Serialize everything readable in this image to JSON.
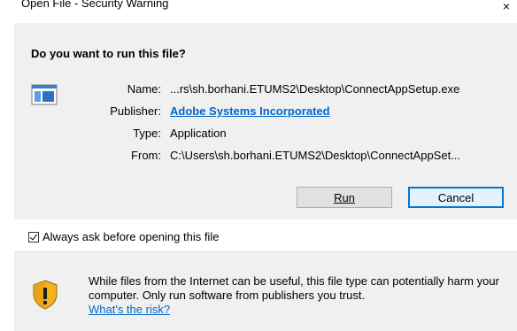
{
  "window": {
    "title": "Open File - Security Warning",
    "close_glyph": "×"
  },
  "question": "Do you want to run this file?",
  "details": {
    "name_label": "Name:",
    "name_value": "...rs\\sh.borhani.ETUMS2\\Desktop\\ConnectAppSetup.exe",
    "publisher_label": "Publisher:",
    "publisher_value": "Adobe Systems Incorporated",
    "type_label": "Type:",
    "type_value": "Application",
    "from_label": "From:",
    "from_value": "C:\\Users\\sh.borhani.ETUMS2\\Desktop\\ConnectAppSet..."
  },
  "buttons": {
    "run_label": "Run",
    "cancel_label": "Cancel"
  },
  "checkbox": {
    "label": "Always ask before opening this file",
    "checked": true
  },
  "warning": {
    "text": "While files from the Internet can be useful, this file type can potentially harm your computer. Only run software from publishers you trust.",
    "link": "What's the risk?"
  },
  "icons": {
    "app": "application-icon",
    "shield": "shield-warning-icon"
  },
  "colors": {
    "link": "#0066cc",
    "panel": "#f0f0f0",
    "default_button_border": "#0078d7"
  }
}
